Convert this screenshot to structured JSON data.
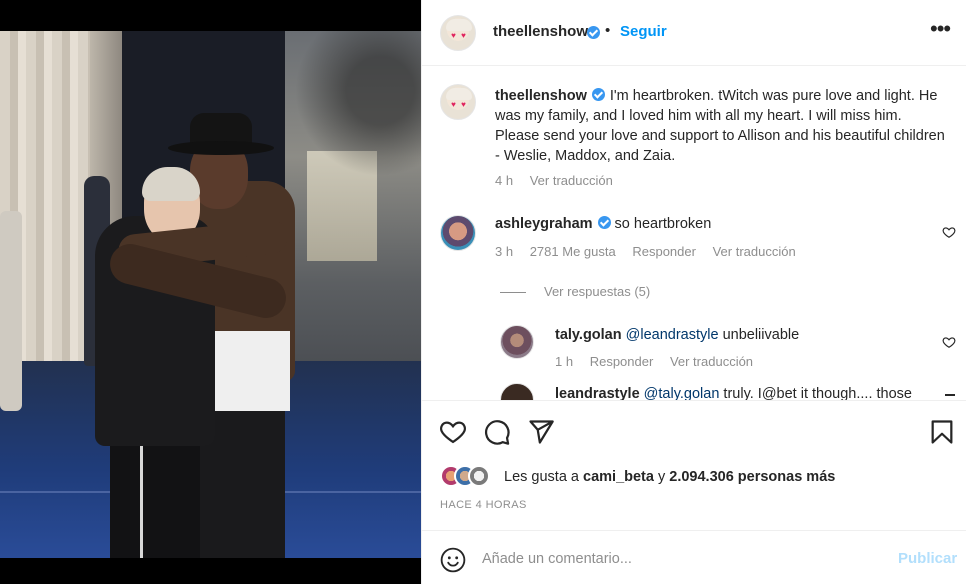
{
  "post": {
    "author": "theellenshow",
    "follow_label": "Seguir",
    "caption_author": "theellenshow",
    "caption": "I'm heartbroken. tWitch was pure love and light. He was my family, and I loved him with all my heart. I will miss him. Please send your love and support to Allison and his beautiful children - Weslie, Maddox, and Zaia.",
    "caption_time": "4 h",
    "caption_translate": "Ver traducción"
  },
  "comments": [
    {
      "user": "ashleygraham",
      "text": "so heartbroken",
      "time": "3 h",
      "likes": "2781 Me gusta",
      "reply": "Responder",
      "translate": "Ver traducción",
      "view_replies": "Ver respuestas (5)"
    },
    {
      "user": "taly.golan",
      "mention": "@leandrastyle",
      "text": "unbeliivable",
      "time": "1 h",
      "reply": "Responder",
      "translate": "Ver traducción"
    },
    {
      "user": "leandrastyle",
      "mention": "@taly.golan",
      "text": "truly. I@bet it though.... those"
    }
  ],
  "likes": {
    "prefix": "Les gusta a",
    "first_user": "cami_beta",
    "joiner": "y",
    "others": "2.094.306 personas más"
  },
  "timestamp": "HACE 4 HORAS",
  "add_comment": {
    "placeholder": "Añade un comentario...",
    "publish_label": "Publicar"
  },
  "colors": {
    "link_blue": "#0095f6",
    "publish_disabled": "#b2dffc",
    "verified": "#3897f0",
    "muted_text": "#8e8e8e"
  },
  "icons": [
    "verified-badge-icon",
    "more-options-icon",
    "heart-icon",
    "comment-icon",
    "share-icon",
    "bookmark-icon",
    "emoji-icon"
  ]
}
